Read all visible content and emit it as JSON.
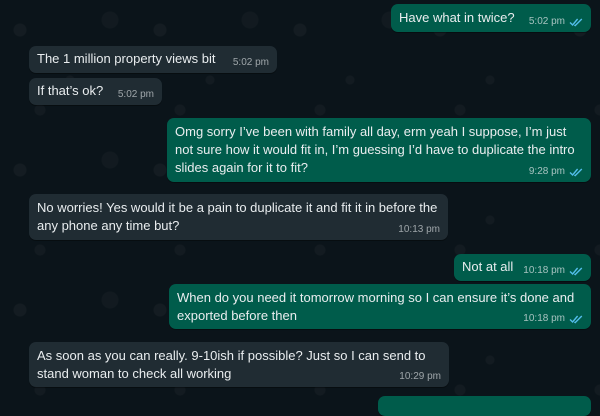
{
  "colors": {
    "background": "#0b141a",
    "incoming_bubble": "#202c33",
    "outgoing_bubble": "#005c4b",
    "read_ticks": "#53bdeb"
  },
  "messages": [
    {
      "direction": "outgoing",
      "text": "Have what in twice?",
      "time": "5:02 pm",
      "status": "read"
    },
    {
      "direction": "incoming",
      "text": "The 1 million property views bit",
      "time": "5:02 pm"
    },
    {
      "direction": "incoming",
      "text": "If that’s ok?",
      "time": "5:02 pm"
    },
    {
      "direction": "outgoing",
      "text": "Omg sorry I’ve been with family all day, erm yeah I suppose, I’m just not sure how it would fit in, I’m guessing I’d have to duplicate the intro slides again for it to fit?",
      "time": "9:28 pm",
      "status": "read"
    },
    {
      "direction": "incoming",
      "text": "No worries! Yes would it be a pain to duplicate it and fit it in before the any phone any time but?",
      "time": "10:13 pm"
    },
    {
      "direction": "outgoing",
      "text": "Not at all",
      "time": "10:18 pm",
      "status": "read"
    },
    {
      "direction": "outgoing",
      "text": "When do you need it tomorrow morning so I can ensure it’s done and exported before then",
      "time": "10:18 pm",
      "status": "read"
    },
    {
      "direction": "incoming",
      "text": "As soon as you can really. 9-10ish if possible? Just so I can send to stand woman to check all working",
      "time": "10:29 pm"
    }
  ]
}
